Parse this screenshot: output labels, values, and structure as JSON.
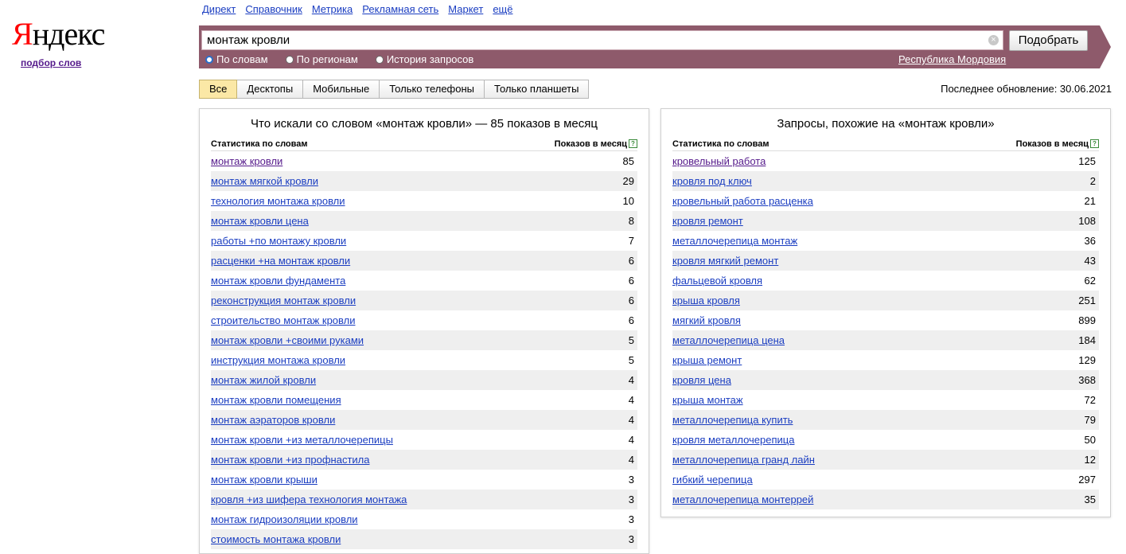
{
  "logo": {
    "first": "Я",
    "rest": "ндекс"
  },
  "sublink": "подбор слов",
  "topnav": [
    "Директ",
    "Справочник",
    "Метрика",
    "Рекламная сеть",
    "Маркет",
    "ещё"
  ],
  "search": {
    "value": "монтаж кровли",
    "submit_label": "Подобрать",
    "options": [
      "По словам",
      "По регионам",
      "История запросов"
    ],
    "selected_option": "По словам",
    "region": "Республика Мордовия"
  },
  "tabs": [
    "Все",
    "Десктопы",
    "Мобильные",
    "Только телефоны",
    "Только планшеты"
  ],
  "active_tab": "Все",
  "updated": "Последнее обновление: 30.06.2021",
  "left": {
    "title": "Что искали со словом «монтаж кровли» — 85 показов в месяц",
    "col1": "Статистика по словам",
    "col2": "Показов в месяц",
    "rows": [
      {
        "phrase": "монтаж кровли",
        "count": "85"
      },
      {
        "phrase": "монтаж мягкой кровли",
        "count": "29"
      },
      {
        "phrase": "технология монтажа кровли",
        "count": "10"
      },
      {
        "phrase": "монтаж кровли цена",
        "count": "8"
      },
      {
        "phrase": "работы +по монтажу кровли",
        "count": "7"
      },
      {
        "phrase": "расценки +на монтаж кровли",
        "count": "6"
      },
      {
        "phrase": "монтаж кровли фундамента",
        "count": "6"
      },
      {
        "phrase": "реконструкция монтаж кровли",
        "count": "6"
      },
      {
        "phrase": "строительство монтаж кровли",
        "count": "6"
      },
      {
        "phrase": "монтаж кровли +своими руками",
        "count": "5"
      },
      {
        "phrase": "инструкция монтажа кровли",
        "count": "5"
      },
      {
        "phrase": "монтаж жилой кровли",
        "count": "4"
      },
      {
        "phrase": "монтаж кровли помещения",
        "count": "4"
      },
      {
        "phrase": "монтаж аэраторов кровли",
        "count": "4"
      },
      {
        "phrase": "монтаж кровли +из металлочерепицы",
        "count": "4"
      },
      {
        "phrase": "монтаж кровли +из профнастила",
        "count": "4"
      },
      {
        "phrase": "монтаж кровли крыши",
        "count": "3"
      },
      {
        "phrase": "кровля +из шифера технология монтажа",
        "count": "3"
      },
      {
        "phrase": "монтаж гидроизоляции кровли",
        "count": "3"
      },
      {
        "phrase": "стоимость монтажа кровли",
        "count": "3"
      }
    ]
  },
  "right": {
    "title": "Запросы, похожие на «монтаж кровли»",
    "col1": "Статистика по словам",
    "col2": "Показов в месяц",
    "rows": [
      {
        "phrase": "кровельный работа",
        "count": "125"
      },
      {
        "phrase": "кровля под ключ",
        "count": "2"
      },
      {
        "phrase": "кровельный работа расценка",
        "count": "21"
      },
      {
        "phrase": "кровля ремонт",
        "count": "108"
      },
      {
        "phrase": "металлочерепица монтаж",
        "count": "36"
      },
      {
        "phrase": "кровля мягкий ремонт",
        "count": "43"
      },
      {
        "phrase": "фальцевой кровля",
        "count": "62"
      },
      {
        "phrase": "крыша кровля",
        "count": "251"
      },
      {
        "phrase": "мягкий кровля",
        "count": "899"
      },
      {
        "phrase": "металлочерепица цена",
        "count": "184"
      },
      {
        "phrase": "крыша ремонт",
        "count": "129"
      },
      {
        "phrase": "кровля цена",
        "count": "368"
      },
      {
        "phrase": "крыша монтаж",
        "count": "72"
      },
      {
        "phrase": "металлочерепица купить",
        "count": "79"
      },
      {
        "phrase": "кровля металлочерепица",
        "count": "50"
      },
      {
        "phrase": "металлочерепица гранд лайн",
        "count": "12"
      },
      {
        "phrase": "гибкий черепица",
        "count": "297"
      },
      {
        "phrase": "металлочерепица монтеррей",
        "count": "35"
      }
    ]
  }
}
